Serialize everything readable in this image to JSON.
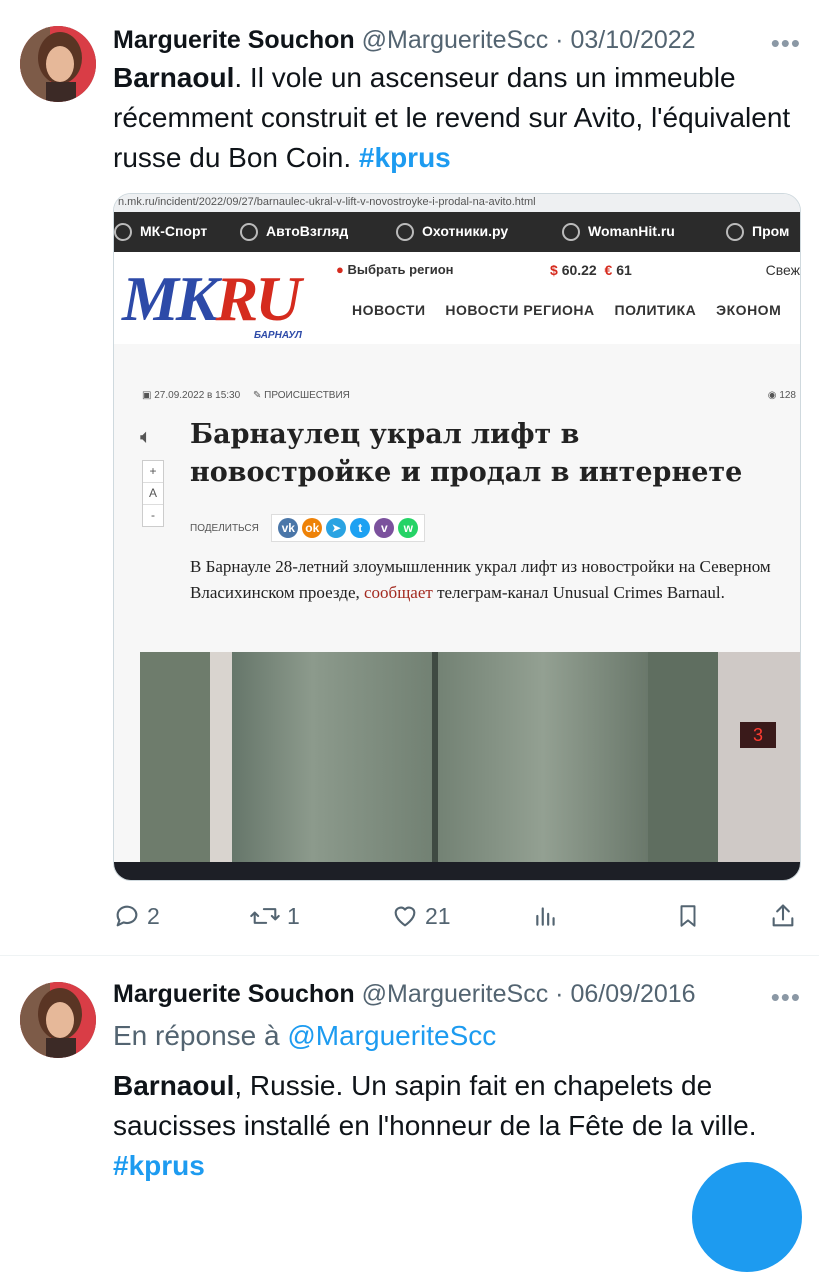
{
  "tweet1": {
    "author_name": "Marguerite Souchon",
    "handle": "@MargueriteScc",
    "separator": "·",
    "date": "03/10/2022",
    "more": "•••",
    "text_bold": "Barnaoul",
    "text_rest": ". Il vole un ascenseur dans un immeuble récemment construit et le revend sur Avito, l'équivalent russe du Bon Coin. ",
    "hashtag": "#kprus",
    "media": {
      "url": "n.mk.ru/incident/2022/09/27/barnaulec-ukral-v-lift-v-novostroyke-i-prodal-na-avito.html",
      "partners": [
        "МК-Спорт",
        "АвтоВзгляд",
        "Охотники.ру",
        "WomanHit.ru",
        "Пром"
      ],
      "logo_mk": "MK",
      "logo_ru": "RU",
      "logo_city": "БАРНАУЛ",
      "region_label": "Выбрать регион",
      "rate_usd_symbol": "$",
      "rate_usd": "60.22",
      "rate_eur_symbol": "€",
      "rate_eur": "61",
      "fresh_label": "Свеж",
      "nav": [
        "НОВОСТИ",
        "НОВОСТИ РЕГИОНА",
        "ПОЛИТИКА",
        "ЭКОНОМ"
      ],
      "meta_date": "27.09.2022 в 15:30",
      "meta_category": "ПРОИСШЕСТВИЯ",
      "views": "128",
      "font_controls": [
        "+",
        "A",
        "-"
      ],
      "headline": "Барнаулец украл лифт в новостройке и продал в интернете",
      "share_label": "ПОДЕЛИТЬСЯ",
      "share_icons": [
        {
          "name": "vk-icon",
          "glyph": "vk",
          "color": "#4a76a8"
        },
        {
          "name": "odnoklassniki-icon",
          "glyph": "ok",
          "color": "#ee8208"
        },
        {
          "name": "telegram-icon",
          "glyph": "➤",
          "color": "#2aa3e2"
        },
        {
          "name": "twitter-icon",
          "glyph": "t",
          "color": "#1da1f2"
        },
        {
          "name": "viber-icon",
          "glyph": "v",
          "color": "#7b519d"
        },
        {
          "name": "whatsapp-icon",
          "glyph": "w",
          "color": "#25d366"
        }
      ],
      "lede_before": "В Барнауле 28-летний злоумышленник украл лифт из новостройки на Северном Власихинском проезде, ",
      "lede_link": "сообщает",
      "lede_after": " телеграм-канал Unusual Crimes Barnaul."
    },
    "actions": {
      "reply_count": "2",
      "retweet_count": "1",
      "like_count": "21"
    },
    "colors": {
      "hashtag": "#1d9bf0",
      "secondary": "#536471"
    }
  },
  "tweet2": {
    "author_name": "Marguerite Souchon",
    "handle": "@MargueriteScc",
    "separator": "·",
    "date": "06/09/2016",
    "more": "•••",
    "reply_prefix": "En réponse à",
    "reply_mention": "@MargueriteScc",
    "text_bold": "Barnaoul",
    "text_rest": ", Russie. Un sapin fait en chapelets de saucisses installé en l'honneur de la Fête de la ville. ",
    "hashtag": "#kprus"
  }
}
